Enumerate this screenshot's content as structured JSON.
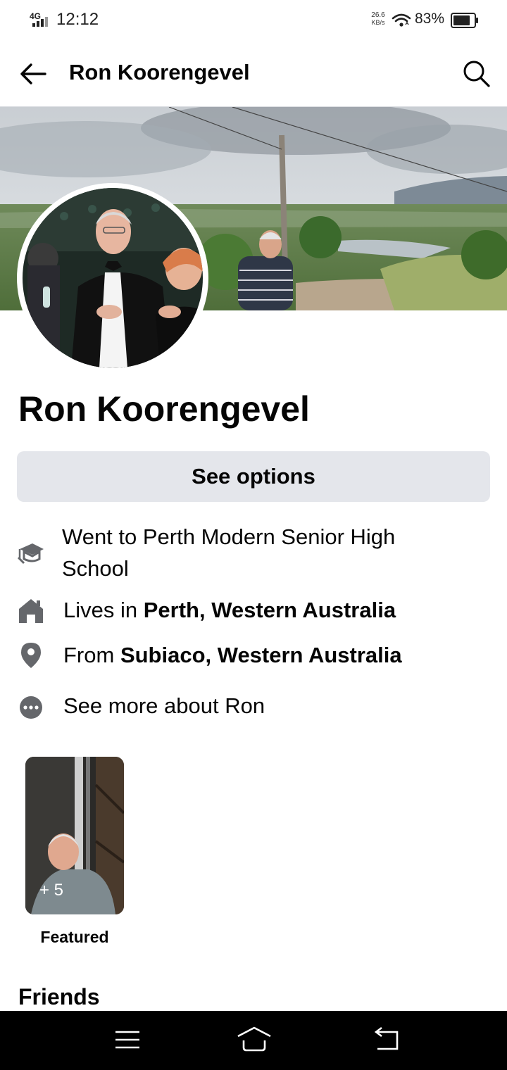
{
  "status_bar": {
    "network": "4G",
    "time": "12:12",
    "speed_value": "26.6",
    "speed_unit": "KB/s",
    "battery_percent": "83%",
    "battery_level": 0.83
  },
  "header": {
    "title": "Ron Koorengevel"
  },
  "profile": {
    "name": "Ron Koorengevel",
    "see_options_label": "See options"
  },
  "about": {
    "education": "Went to Perth Modern Senior High School",
    "lives_prefix": "Lives in ",
    "lives_place": "Perth, Western Australia",
    "from_prefix": "From ",
    "from_place": "Subiaco, Western Australia",
    "see_more": "See more about Ron"
  },
  "featured": {
    "count": "+ 5",
    "label": "Featured"
  },
  "sections": {
    "friends_title": "Friends"
  },
  "icons": {
    "back": "arrow-left-icon",
    "search": "search-icon",
    "education": "graduation-cap-icon",
    "home": "house-icon",
    "location": "map-pin-icon",
    "more": "more-dots-icon"
  },
  "colors": {
    "button_bg": "#e4e6eb",
    "text": "#050505",
    "icon_gray": "#65676b",
    "nav_bar": "#000000"
  }
}
